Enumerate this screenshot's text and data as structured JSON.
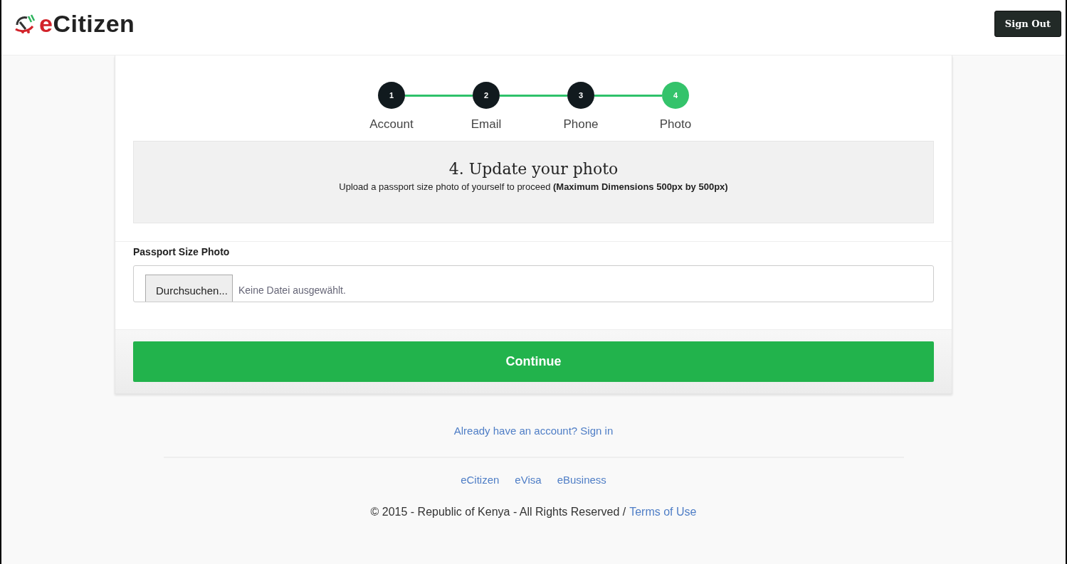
{
  "header": {
    "logo": "eCitizen",
    "sign_out": "Sign Out"
  },
  "steps": [
    {
      "number": "1",
      "label": "Account",
      "selected": false
    },
    {
      "number": "2",
      "label": "Email",
      "selected": false
    },
    {
      "number": "3",
      "label": "Phone",
      "selected": false
    },
    {
      "number": "4",
      "label": "Photo",
      "selected": true
    }
  ],
  "intro": {
    "title": "4. Update your photo",
    "description": "Upload a passport size photo of yourself to proceed **(Maximum Dimensions 500px by 500px)**"
  },
  "field": {
    "label": "Passport Size Photo",
    "button": "Durchsuchen...",
    "value": "Keine Datei ausgewählt."
  },
  "continue": "Continue",
  "sign_in_link": "Already have an account? Sign in",
  "footer": {
    "links": [
      "eCitizen",
      "eVisa",
      "eBusiness"
    ],
    "copyright": "© 2015 - Republic of Kenya - All Rights Reserved /",
    "terms": "Terms of Use"
  }
}
